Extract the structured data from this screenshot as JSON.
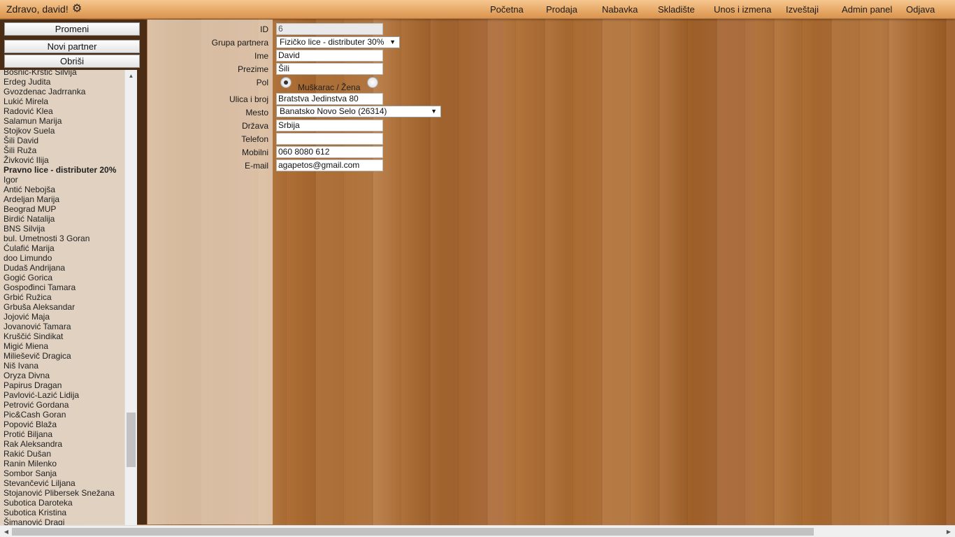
{
  "header": {
    "greeting": "Zdravo, david!",
    "settings_icon": "gear-icon",
    "nav": [
      "Početna",
      "Prodaja",
      "Nabavka",
      "Skladište",
      "Unos i izmena",
      "Izveštaji",
      "Admin panel",
      "Odjava"
    ]
  },
  "sidebar": {
    "buttons": {
      "change": "Promeni",
      "new_partner": "Novi partner",
      "delete": "Obriši"
    },
    "partners": [
      {
        "name": "Bosnić-Krstić Silvija",
        "group": false
      },
      {
        "name": "Erdeg Judita",
        "group": false
      },
      {
        "name": "Gvozdenac Jadrranka",
        "group": false
      },
      {
        "name": "Lukić Mirela",
        "group": false
      },
      {
        "name": "Radović Klea",
        "group": false
      },
      {
        "name": "Salamun Marija",
        "group": false
      },
      {
        "name": "Stojkov Suela",
        "group": false
      },
      {
        "name": "Šili David",
        "group": false
      },
      {
        "name": "Šili Ruža",
        "group": false
      },
      {
        "name": "Živković Ilija",
        "group": false
      },
      {
        "name": "Pravno lice - distributer 20%",
        "group": true
      },
      {
        "name": "Igor",
        "group": false
      },
      {
        "name": "Antić Nebojša",
        "group": false
      },
      {
        "name": "Ardeljan Marija",
        "group": false
      },
      {
        "name": "Beograd MUP",
        "group": false
      },
      {
        "name": "Birdić Natalija",
        "group": false
      },
      {
        "name": "BNS Silvija",
        "group": false
      },
      {
        "name": "bul. Umetnosti 3 Goran",
        "group": false
      },
      {
        "name": "Ćulafić Marija",
        "group": false
      },
      {
        "name": "doo Limundo",
        "group": false
      },
      {
        "name": "Dudaš Andrijana",
        "group": false
      },
      {
        "name": "Gogić Gorica",
        "group": false
      },
      {
        "name": "Gospođinci Tamara",
        "group": false
      },
      {
        "name": "Grbić Ružica",
        "group": false
      },
      {
        "name": "Grbuša Aleksandar",
        "group": false
      },
      {
        "name": "Jojović Maja",
        "group": false
      },
      {
        "name": "Jovanović Tamara",
        "group": false
      },
      {
        "name": "Kruščić Sindikat",
        "group": false
      },
      {
        "name": "Migić Miena",
        "group": false
      },
      {
        "name": "Milieševič Dragica",
        "group": false
      },
      {
        "name": "Niš Ivana",
        "group": false
      },
      {
        "name": "Oryza Divna",
        "group": false
      },
      {
        "name": "Papirus Dragan",
        "group": false
      },
      {
        "name": "Pavlović-Lazić Lidija",
        "group": false
      },
      {
        "name": "Petrović Gordana",
        "group": false
      },
      {
        "name": "Pic&Cash Goran",
        "group": false
      },
      {
        "name": "Popović Blaža",
        "group": false
      },
      {
        "name": "Protić Biljana",
        "group": false
      },
      {
        "name": "Rak Aleksandra",
        "group": false
      },
      {
        "name": "Rakić Dušan",
        "group": false
      },
      {
        "name": "Ranin Milenko",
        "group": false
      },
      {
        "name": "Sombor Sanja",
        "group": false
      },
      {
        "name": "Stevančević Liljana",
        "group": false
      },
      {
        "name": "Stojanović Plibersek Snežana",
        "group": false
      },
      {
        "name": "Subotica Daroteka",
        "group": false
      },
      {
        "name": "Subotica Kristina",
        "group": false
      },
      {
        "name": "Šimanović Dragi",
        "group": false
      }
    ]
  },
  "form": {
    "id": {
      "label": "ID",
      "value": "6"
    },
    "group": {
      "label": "Grupa partnera",
      "value": "Fizičko lice - distributer 30%"
    },
    "first_name": {
      "label": "Ime",
      "value": "David"
    },
    "last_name": {
      "label": "Prezime",
      "value": "Šili"
    },
    "gender": {
      "label": "Pol",
      "options_text": "Muškarac / Žena",
      "selected": "Muškarac"
    },
    "street": {
      "label": "Ulica i broj",
      "value": "Bratstva Jedinstva 80"
    },
    "city": {
      "label": "Mesto",
      "value": "Banatsko Novo Selo (26314)"
    },
    "country": {
      "label": "Država",
      "value": "Srbija"
    },
    "phone": {
      "label": "Telefon",
      "value": ""
    },
    "mobile": {
      "label": "Mobilni",
      "value": "060 8080 612"
    },
    "email": {
      "label": "E-mail",
      "value": "agapetos@gmail.com"
    }
  }
}
